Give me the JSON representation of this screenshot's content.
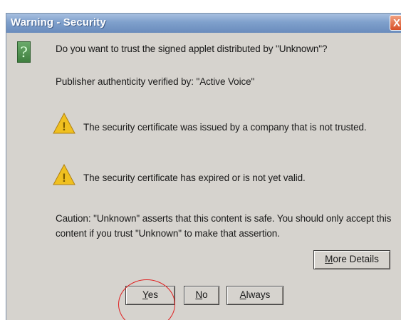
{
  "window": {
    "title": "Warning - Security",
    "close_glyph": "X"
  },
  "icons": {
    "question": "question-icon",
    "warning": "warning-icon",
    "question_glyph": "?",
    "warning_glyph": "!"
  },
  "content": {
    "question": "Do you want to trust the signed applet distributed by \"Unknown\"?",
    "publisher": "Publisher authenticity verified by: \"Active Voice\"",
    "warning_1": "The security certificate was issued by a company that is not trusted.",
    "warning_2": "The security certificate has expired or is not yet valid.",
    "caution_line_1": "Caution: \"Unknown\" asserts that this content is safe. You should only accept this",
    "caution_line_2": "content if you trust \"Unknown\" to make that assertion."
  },
  "buttons": {
    "more_details": {
      "mnemonic": "M",
      "rest": "ore Details"
    },
    "yes": {
      "mnemonic": "Y",
      "rest": "es"
    },
    "no": {
      "mnemonic": "N",
      "rest": "o"
    },
    "always": {
      "mnemonic": "A",
      "rest": "lways"
    }
  },
  "colors": {
    "title_bar": "#7fa0cc",
    "dialog_bg": "#d6d3ce",
    "highlight_circle": "#e02020",
    "warning_yellow": "#f0c020"
  }
}
